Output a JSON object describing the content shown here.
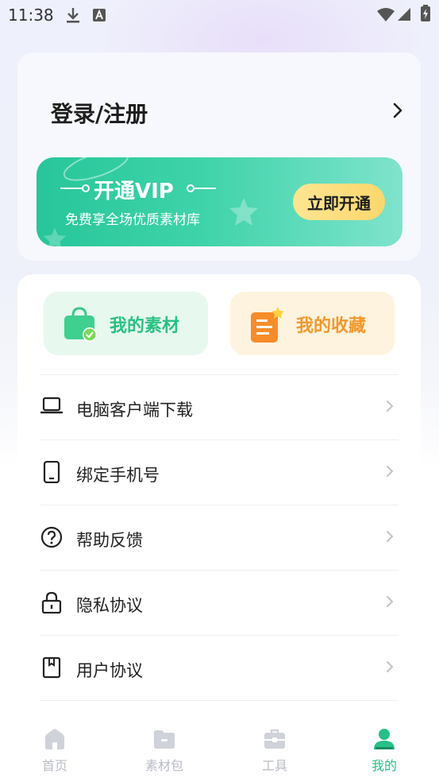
{
  "status_bar": {
    "time": "11:38",
    "icons": [
      "download-icon",
      "font-a-icon",
      "wifi-icon",
      "signal-icon",
      "battery-icon"
    ]
  },
  "login": {
    "title": "登录/注册",
    "arrow_icon": "chevron-right-icon"
  },
  "vip": {
    "title": "开通VIP",
    "subtitle": "免费享全场优质素材库",
    "button_label": "立即开通"
  },
  "quick_actions": [
    {
      "label": "我的素材",
      "icon": "shopping-bag-check-icon"
    },
    {
      "label": "我的收藏",
      "icon": "document-star-icon"
    }
  ],
  "menu": [
    {
      "label": "电脑客户端下载",
      "icon": "laptop-icon"
    },
    {
      "label": "绑定手机号",
      "icon": "phone-icon"
    },
    {
      "label": "帮助反馈",
      "icon": "help-circle-icon"
    },
    {
      "label": "隐私协议",
      "icon": "lock-icon"
    },
    {
      "label": "用户协议",
      "icon": "bookmark-doc-icon"
    }
  ],
  "tabs": [
    {
      "label": "首页",
      "icon": "home-icon",
      "active": false
    },
    {
      "label": "素材包",
      "icon": "folder-icon",
      "active": false
    },
    {
      "label": "工具",
      "icon": "toolbox-icon",
      "active": false
    },
    {
      "label": "我的",
      "icon": "user-icon",
      "active": true
    }
  ],
  "colors": {
    "accent_green": "#27c087",
    "vip_gradient_start": "#27c69a",
    "vip_button": "#fbd76c",
    "favorite_orange": "#f3972b",
    "tab_inactive": "#b8bcc6"
  }
}
